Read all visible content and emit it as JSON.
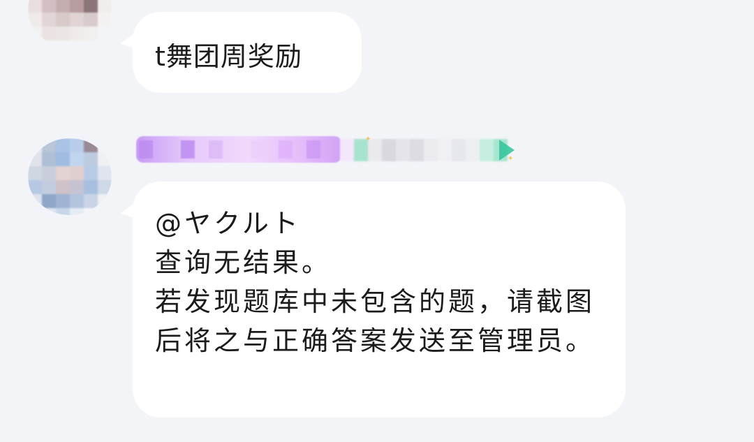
{
  "chat": {
    "messages": [
      {
        "sender": "user",
        "text": "t舞团周奖励"
      },
      {
        "sender": "bot",
        "text": "@ヤクルト\n查询无结果。\n若发现题库中未包含的题，请截图后将之与正确答案发送至管理员。"
      }
    ]
  },
  "colors": {
    "background": "#f3f4f8",
    "bubble": "#ffffff",
    "text": "#1b1b1b",
    "name_badge": "#c79cf5",
    "name_badge_end": "#2ec49a"
  }
}
